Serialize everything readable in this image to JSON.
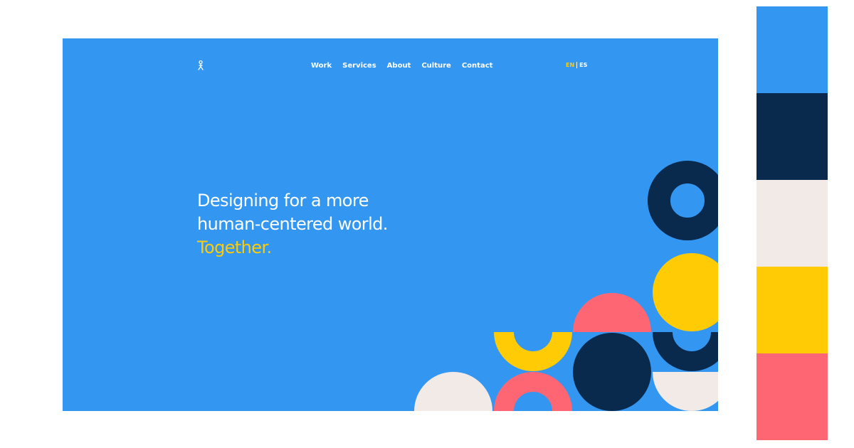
{
  "nav": {
    "items": [
      {
        "label": "Work"
      },
      {
        "label": "Services"
      },
      {
        "label": "About"
      },
      {
        "label": "Culture"
      },
      {
        "label": "Contact"
      }
    ]
  },
  "lang": {
    "active": "EN",
    "other": "ES"
  },
  "hero": {
    "line1": "Designing for a more",
    "line2": "human-centered world.",
    "line3": "Together."
  },
  "colors": {
    "blue": "#3397F2",
    "navy": "#0A2A4D",
    "cream": "#F2EAE6",
    "yellow": "#FFCB05",
    "coral": "#FF6673"
  },
  "palette": [
    "#3397F2",
    "#0A2A4D",
    "#F2EAE6",
    "#FFCB05",
    "#FF6673"
  ]
}
